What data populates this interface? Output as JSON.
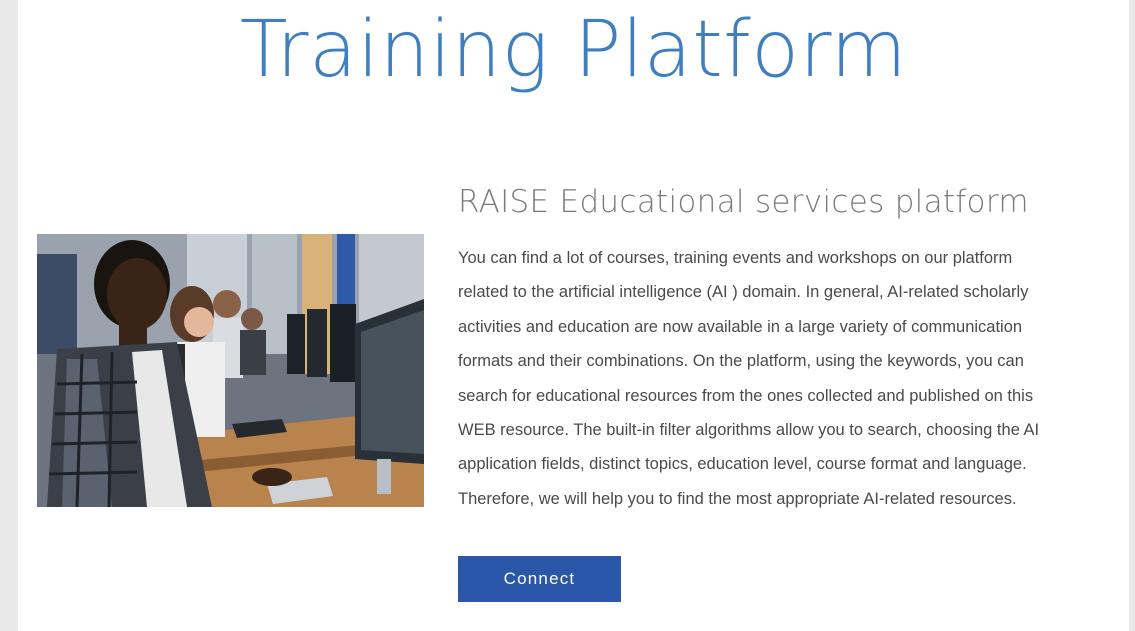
{
  "hero": {
    "title": "Training Platform"
  },
  "section": {
    "title": "RAISE Educational services platform",
    "description_lines": [
      "You can find a lot of courses, training events and workshops on our platform",
      "related to the artificial intelligence (AI ) domain. In general, AI-related scholarly",
      "activities and education are now available in a large variety of communication",
      "formats and their combinations. On the platform, using the keywords, you can",
      "search for educational resources from the ones collected and published on this",
      "WEB resource. The built-in filter algorithms allow you to search, choosing the AI",
      "application fields, distinct topics, education level, course format and language.",
      "Therefore, we will help you to find the most appropriate AI-related resources."
    ]
  },
  "actions": {
    "connect_label": "Connect"
  },
  "colors": {
    "title": "#3f7fbf",
    "button": "#2a57a8",
    "subtitle": "#7a7a7a",
    "body_text": "#4a4a4a"
  }
}
